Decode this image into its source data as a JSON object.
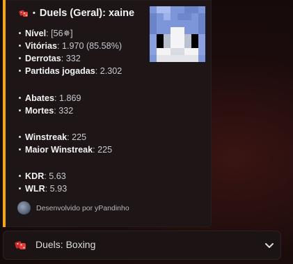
{
  "embed": {
    "title_prefix": "•",
    "title": "Duels (Geral): xaine",
    "accent_color": "#f2a71b",
    "stats_group1": [
      {
        "label": "Nível",
        "value": ": [56✵]"
      },
      {
        "label": "Vitórias",
        "value": ": 1.970 (85.58%)"
      },
      {
        "label": "Derrotas",
        "value": ": 332"
      },
      {
        "label": "Partidas jogadas",
        "value": ": 2.302"
      }
    ],
    "stats_group2": [
      {
        "label": "Abates",
        "value": ": 1.869"
      },
      {
        "label": "Mortes",
        "value": ": 332"
      }
    ],
    "stats_group3": [
      {
        "label": "Winstreak",
        "value": ": 225"
      },
      {
        "label": "Maior Winstreak",
        "value": ": 225"
      }
    ],
    "stats_group4": [
      {
        "label": "KDR",
        "value": ": 5.63"
      },
      {
        "label": "WLR",
        "value": ": 5.93"
      }
    ],
    "footer_text": "Desenvolvido por yPandinho",
    "title_icon": "red-dice-icon",
    "thumbnail_icon": "minecraft-skin-head-icon"
  },
  "select": {
    "label": "Duels: Boxing",
    "icon": "red-dice-icon",
    "chevron": "chevron-down-icon"
  }
}
